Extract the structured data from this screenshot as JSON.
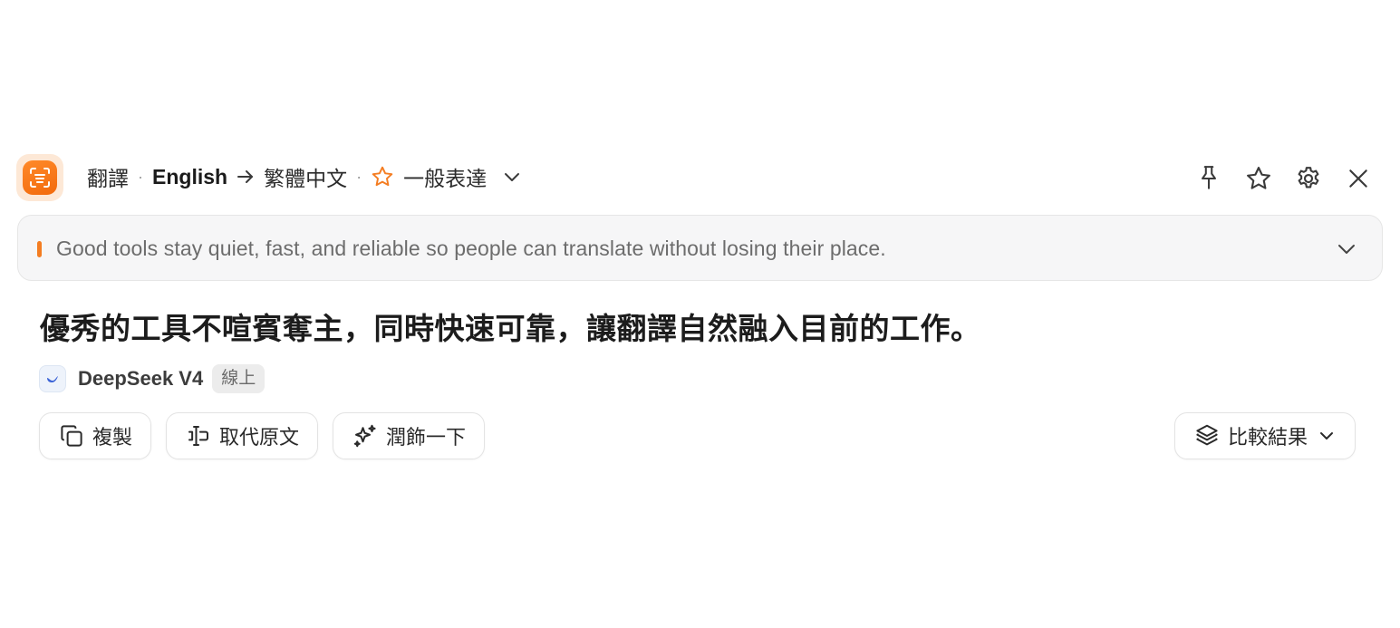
{
  "header": {
    "mode_label": "翻譯",
    "separator": "·",
    "source_language": "English",
    "target_language": "繁體中文",
    "style_label": "一般表達"
  },
  "header_actions": [
    {
      "name": "pin-button",
      "icon": "pin-icon"
    },
    {
      "name": "favorite-button",
      "icon": "star-icon"
    },
    {
      "name": "settings-button",
      "icon": "gear-icon"
    },
    {
      "name": "close-button",
      "icon": "close-icon"
    }
  ],
  "source": {
    "text": "Good tools stay quiet, fast, and reliable so people can translate without losing their place."
  },
  "translation": {
    "text": "優秀的工具不喧賓奪主，同時快速可靠，讓翻譯自然融入目前的工作。"
  },
  "engine": {
    "name": "DeepSeek V4",
    "status": "線上"
  },
  "actions": {
    "copy_label": "複製",
    "replace_label": "取代原文",
    "polish_label": "潤飾一下",
    "compare_label": "比較結果"
  },
  "colors": {
    "accent": "#f47d22",
    "star": "#f47d22"
  }
}
